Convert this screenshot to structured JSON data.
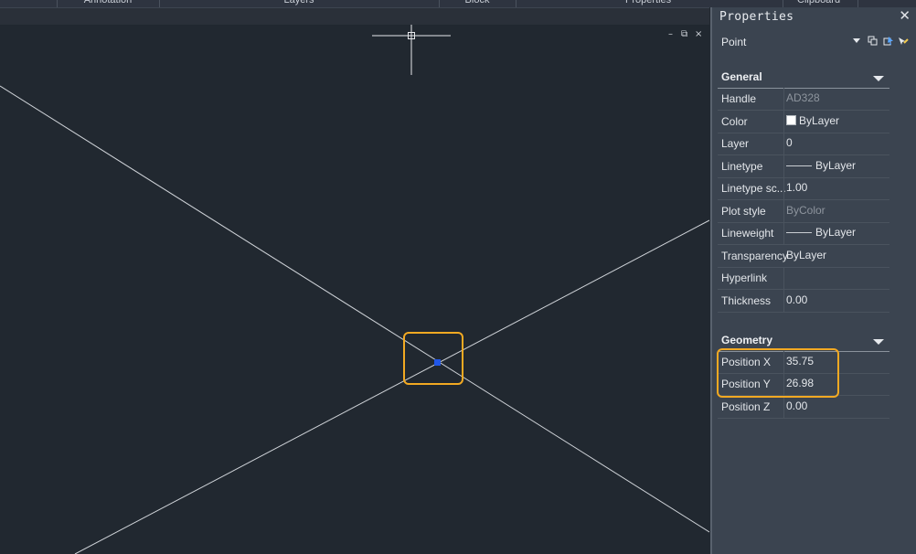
{
  "ribbon": {
    "panels": [
      "Annotation",
      "Layers",
      "Block",
      "Properties",
      "Clipboard"
    ]
  },
  "drawing": {
    "window_controls": {
      "minimize": "–",
      "restore": "⧉",
      "close": "×"
    },
    "selected_point": {
      "x": 35.75,
      "y": 26.98
    }
  },
  "properties": {
    "title": "Properties",
    "close": "✕",
    "selection": "Point",
    "general": {
      "title": "General",
      "rows": [
        {
          "label": "Handle",
          "value": "AD328"
        },
        {
          "label": "Color",
          "value": "ByLayer"
        },
        {
          "label": "Layer",
          "value": "0"
        },
        {
          "label": "Linetype",
          "value": "ByLayer"
        },
        {
          "label": "Linetype sc...",
          "value": "1.00"
        },
        {
          "label": "Plot style",
          "value": "ByColor"
        },
        {
          "label": "Lineweight",
          "value": "ByLayer"
        },
        {
          "label": "Transparency",
          "value": "ByLayer"
        },
        {
          "label": "Hyperlink",
          "value": ""
        },
        {
          "label": "Thickness",
          "value": "0.00"
        }
      ]
    },
    "geometry": {
      "title": "Geometry",
      "rows": [
        {
          "label": "Position X",
          "value": "35.75"
        },
        {
          "label": "Position Y",
          "value": "26.98"
        },
        {
          "label": "Position Z",
          "value": "0.00"
        }
      ]
    }
  },
  "colors": {
    "canvas_bg": "#212830",
    "panel_bg": "#3b4450",
    "highlight": "#f2a922",
    "point": "#2157e8"
  }
}
